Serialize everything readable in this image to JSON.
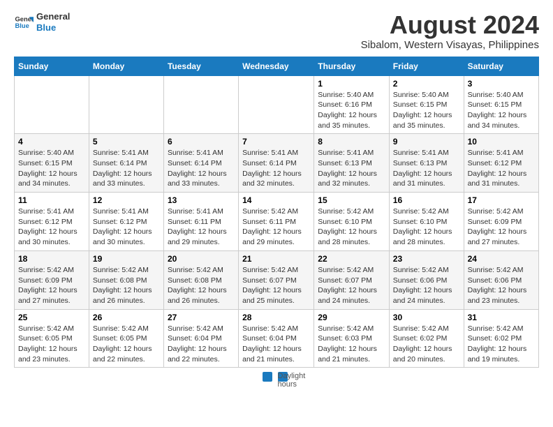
{
  "logo": {
    "line1": "General",
    "line2": "Blue"
  },
  "title": "August 2024",
  "subtitle": "Sibalom, Western Visayas, Philippines",
  "days_header": [
    "Sunday",
    "Monday",
    "Tuesday",
    "Wednesday",
    "Thursday",
    "Friday",
    "Saturday"
  ],
  "weeks": [
    [
      {
        "day": "",
        "info": ""
      },
      {
        "day": "",
        "info": ""
      },
      {
        "day": "",
        "info": ""
      },
      {
        "day": "",
        "info": ""
      },
      {
        "day": "1",
        "info": "Sunrise: 5:40 AM\nSunset: 6:16 PM\nDaylight: 12 hours\nand 35 minutes."
      },
      {
        "day": "2",
        "info": "Sunrise: 5:40 AM\nSunset: 6:15 PM\nDaylight: 12 hours\nand 35 minutes."
      },
      {
        "day": "3",
        "info": "Sunrise: 5:40 AM\nSunset: 6:15 PM\nDaylight: 12 hours\nand 34 minutes."
      }
    ],
    [
      {
        "day": "4",
        "info": "Sunrise: 5:40 AM\nSunset: 6:15 PM\nDaylight: 12 hours\nand 34 minutes."
      },
      {
        "day": "5",
        "info": "Sunrise: 5:41 AM\nSunset: 6:14 PM\nDaylight: 12 hours\nand 33 minutes."
      },
      {
        "day": "6",
        "info": "Sunrise: 5:41 AM\nSunset: 6:14 PM\nDaylight: 12 hours\nand 33 minutes."
      },
      {
        "day": "7",
        "info": "Sunrise: 5:41 AM\nSunset: 6:14 PM\nDaylight: 12 hours\nand 32 minutes."
      },
      {
        "day": "8",
        "info": "Sunrise: 5:41 AM\nSunset: 6:13 PM\nDaylight: 12 hours\nand 32 minutes."
      },
      {
        "day": "9",
        "info": "Sunrise: 5:41 AM\nSunset: 6:13 PM\nDaylight: 12 hours\nand 31 minutes."
      },
      {
        "day": "10",
        "info": "Sunrise: 5:41 AM\nSunset: 6:12 PM\nDaylight: 12 hours\nand 31 minutes."
      }
    ],
    [
      {
        "day": "11",
        "info": "Sunrise: 5:41 AM\nSunset: 6:12 PM\nDaylight: 12 hours\nand 30 minutes."
      },
      {
        "day": "12",
        "info": "Sunrise: 5:41 AM\nSunset: 6:12 PM\nDaylight: 12 hours\nand 30 minutes."
      },
      {
        "day": "13",
        "info": "Sunrise: 5:41 AM\nSunset: 6:11 PM\nDaylight: 12 hours\nand 29 minutes."
      },
      {
        "day": "14",
        "info": "Sunrise: 5:42 AM\nSunset: 6:11 PM\nDaylight: 12 hours\nand 29 minutes."
      },
      {
        "day": "15",
        "info": "Sunrise: 5:42 AM\nSunset: 6:10 PM\nDaylight: 12 hours\nand 28 minutes."
      },
      {
        "day": "16",
        "info": "Sunrise: 5:42 AM\nSunset: 6:10 PM\nDaylight: 12 hours\nand 28 minutes."
      },
      {
        "day": "17",
        "info": "Sunrise: 5:42 AM\nSunset: 6:09 PM\nDaylight: 12 hours\nand 27 minutes."
      }
    ],
    [
      {
        "day": "18",
        "info": "Sunrise: 5:42 AM\nSunset: 6:09 PM\nDaylight: 12 hours\nand 27 minutes."
      },
      {
        "day": "19",
        "info": "Sunrise: 5:42 AM\nSunset: 6:08 PM\nDaylight: 12 hours\nand 26 minutes."
      },
      {
        "day": "20",
        "info": "Sunrise: 5:42 AM\nSunset: 6:08 PM\nDaylight: 12 hours\nand 26 minutes."
      },
      {
        "day": "21",
        "info": "Sunrise: 5:42 AM\nSunset: 6:07 PM\nDaylight: 12 hours\nand 25 minutes."
      },
      {
        "day": "22",
        "info": "Sunrise: 5:42 AM\nSunset: 6:07 PM\nDaylight: 12 hours\nand 24 minutes."
      },
      {
        "day": "23",
        "info": "Sunrise: 5:42 AM\nSunset: 6:06 PM\nDaylight: 12 hours\nand 24 minutes."
      },
      {
        "day": "24",
        "info": "Sunrise: 5:42 AM\nSunset: 6:06 PM\nDaylight: 12 hours\nand 23 minutes."
      }
    ],
    [
      {
        "day": "25",
        "info": "Sunrise: 5:42 AM\nSunset: 6:05 PM\nDaylight: 12 hours\nand 23 minutes."
      },
      {
        "day": "26",
        "info": "Sunrise: 5:42 AM\nSunset: 6:05 PM\nDaylight: 12 hours\nand 22 minutes."
      },
      {
        "day": "27",
        "info": "Sunrise: 5:42 AM\nSunset: 6:04 PM\nDaylight: 12 hours\nand 22 minutes."
      },
      {
        "day": "28",
        "info": "Sunrise: 5:42 AM\nSunset: 6:04 PM\nDaylight: 12 hours\nand 21 minutes."
      },
      {
        "day": "29",
        "info": "Sunrise: 5:42 AM\nSunset: 6:03 PM\nDaylight: 12 hours\nand 21 minutes."
      },
      {
        "day": "30",
        "info": "Sunrise: 5:42 AM\nSunset: 6:02 PM\nDaylight: 12 hours\nand 20 minutes."
      },
      {
        "day": "31",
        "info": "Sunrise: 5:42 AM\nSunset: 6:02 PM\nDaylight: 12 hours\nand 19 minutes."
      }
    ]
  ],
  "footer": {
    "legend_label": "Daylight hours"
  }
}
